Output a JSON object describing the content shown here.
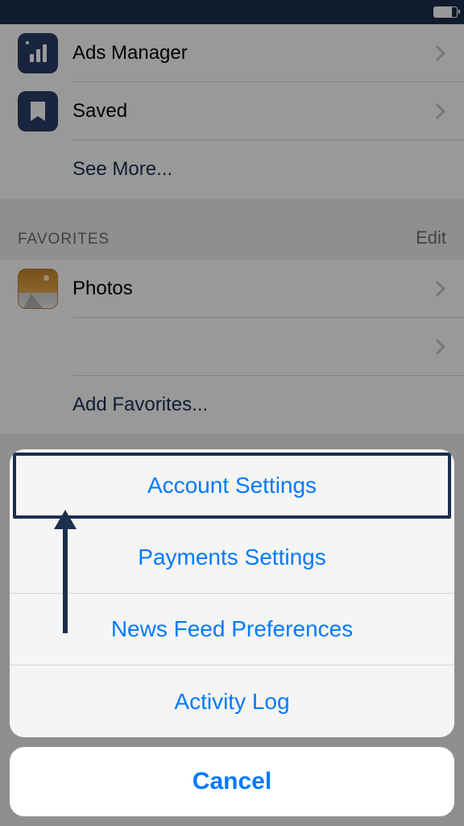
{
  "status": {
    "battery_pct": 80
  },
  "menu": {
    "items": [
      {
        "label": "Ads Manager",
        "icon": "bar-chart"
      },
      {
        "label": "Saved",
        "icon": "bookmark"
      }
    ],
    "seeMore": "See More..."
  },
  "favorites": {
    "title": "FAVORITES",
    "edit": "Edit",
    "items": [
      {
        "label": "Photos",
        "icon": "photo"
      }
    ],
    "add": "Add Favorites..."
  },
  "actionSheet": {
    "options": [
      "Account Settings",
      "Payments Settings",
      "News Feed Preferences",
      "Activity Log"
    ],
    "cancel": "Cancel"
  }
}
